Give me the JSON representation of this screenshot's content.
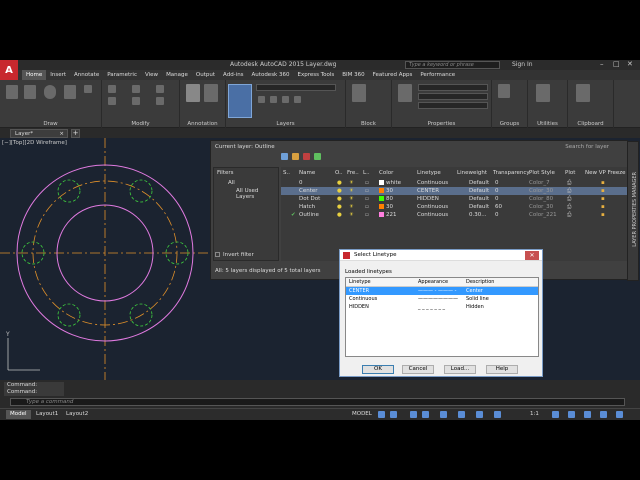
{
  "title_bar": {
    "app_letter": "A",
    "title": "Autodesk AutoCAD 2015    Layer.dwg",
    "search_placeholder": "Type a keyword or phrase",
    "sign_in": "Sign In"
  },
  "ribbon_tabs": [
    "Home",
    "Insert",
    "Annotate",
    "Parametric",
    "View",
    "Manage",
    "Output",
    "Add-ins",
    "Autodesk 360",
    "Express Tools",
    "BIM 360",
    "Featured Apps",
    "Performance"
  ],
  "ribbon_panels": [
    "Draw",
    "Modify",
    "Annotation",
    "Layers",
    "Block",
    "Properties",
    "Groups",
    "Utilities",
    "Clipboard"
  ],
  "doc_tabs": {
    "active": "Layer*",
    "close": "×",
    "add": "+"
  },
  "viewport_label": "[−][Top][2D Wireframe]",
  "layer_manager": {
    "current_layer": "Current layer: Outline",
    "search_placeholder": "Search for layer",
    "filters_title": "Filters",
    "filter_all": "All",
    "filter_used": "All Used Layers",
    "invert_filter": "Invert filter",
    "status_text": "All: 5 layers displayed of 5 total layers",
    "side_label": "LAYER PROPERTIES MANAGER",
    "columns": [
      "S..",
      "Name",
      "O..",
      "Fre..",
      "L..",
      "Color",
      "Linetype",
      "Lineweight",
      "Transparency",
      "Plot Style",
      "Plot",
      "New VP Freeze"
    ],
    "rows": [
      {
        "name": "0",
        "color_name": "white",
        "color_hex": "#ffffff",
        "linetype": "Continuous",
        "lineweight": "Default",
        "transparency": "0",
        "plot_style": "Color_7",
        "selected": false
      },
      {
        "name": "Center",
        "color_name": "30",
        "color_hex": "#ff7f00",
        "linetype": "CENTER",
        "lineweight": "Default",
        "transparency": "0",
        "plot_style": "Color_30",
        "selected": true
      },
      {
        "name": "Dot Dot",
        "color_name": "80",
        "color_hex": "#3fff00",
        "linetype": "HIDDEN",
        "lineweight": "Default",
        "transparency": "0",
        "plot_style": "Color_80",
        "selected": false
      },
      {
        "name": "Hatch",
        "color_name": "30",
        "color_hex": "#ff7f00",
        "linetype": "Continuous",
        "lineweight": "Default",
        "transparency": "60",
        "plot_style": "Color_30",
        "selected": false
      },
      {
        "name": "Outline",
        "color_name": "221",
        "color_hex": "#ff7fdf",
        "linetype": "Continuous",
        "lineweight": "0.30...",
        "transparency": "0",
        "plot_style": "Color_221",
        "selected": false
      }
    ]
  },
  "dialog": {
    "title": "Select Linetype",
    "loaded_label": "Loaded linetypes",
    "columns": [
      "Linetype",
      "Appearance",
      "Description"
    ],
    "rows": [
      {
        "linetype": "CENTER",
        "description": "Center",
        "selected": true
      },
      {
        "linetype": "Continuous",
        "description": "Solid line",
        "selected": false
      },
      {
        "linetype": "HIDDEN",
        "description": "Hidden",
        "selected": false
      }
    ],
    "buttons": {
      "ok": "OK",
      "cancel": "Cancel",
      "load": "Load...",
      "help": "Help"
    }
  },
  "command": {
    "history": [
      "Command:",
      "Command:"
    ],
    "input_placeholder": "Type a command"
  },
  "status_bar": {
    "layout_tabs": [
      "Model",
      "Layout1",
      "Layout2"
    ],
    "model_label": "MODEL",
    "scale": "1:1"
  },
  "drawing_colors": {
    "outline": "#e07ae0",
    "center": "#e0902a",
    "hidden": "#3fcf3f",
    "axis": "#c0c0c0"
  }
}
